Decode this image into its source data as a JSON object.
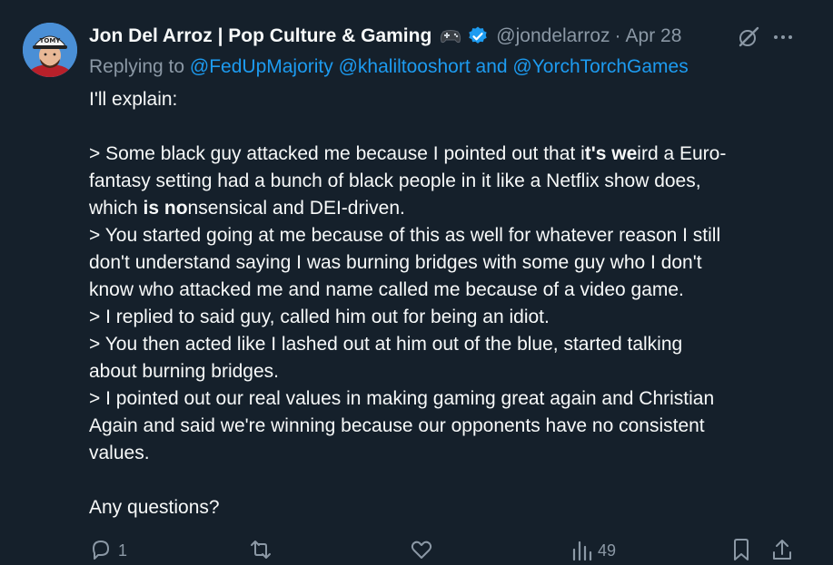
{
  "tweet": {
    "author_name": "Jon Del Arroz | Pop Culture & Gaming",
    "handle": "@jondelarroz",
    "dot": "·",
    "date": "Apr 28",
    "replying_prefix": "Replying to",
    "mention_1": "@FedUpMajority",
    "mention_2": "@khaliltooshort",
    "and": "and",
    "mention_3": "@YorchTorchGames",
    "avatar_cap_text": "TOMY",
    "icons": {
      "verified": "verified-badge-icon",
      "gamepad": "gamepad-icon",
      "grok": "grok-icon",
      "more": "more-options-icon",
      "reply": "reply-icon",
      "retweet": "retweet-icon",
      "like": "like-icon",
      "views": "views-icon",
      "bookmark": "bookmark-icon",
      "share": "share-icon"
    },
    "colors": {
      "background": "#15202b",
      "accent": "#1d9bf0",
      "muted": "#8b98a5",
      "text": "#f7f9f9"
    }
  },
  "body": {
    "l1": "I'll explain:",
    "l2a": "> Some black guy attacked me because I pointed out that i",
    "l2b": "t's we",
    "l2c": "ird a Euro-",
    "l3": "fantasy setting had a bunch of black people in it like a Netflix show does,",
    "l4a": "which ",
    "l4b": "is no",
    "l4c": "nsensical and DEI-driven.",
    "l5": "> You started going at me because of this as well for whatever reason I still",
    "l6": "don't understand saying I was burning bridges with some guy who I don't",
    "l7": "know who attacked me and name called me because of a video game.",
    "l8": "> I replied to said guy, called him out for being an idiot.",
    "l9": "> You then acted like I lashed out at him out of the blue, started talking",
    "l10": "about burning bridges.",
    "l11": "> I pointed out our real values in making gaming great again and Christian",
    "l12": "Again and said we're winning because our opponents have no consistent",
    "l13": "values.",
    "l14": "Any questions?"
  },
  "actions": {
    "reply_count": "1",
    "views_count": "49"
  }
}
